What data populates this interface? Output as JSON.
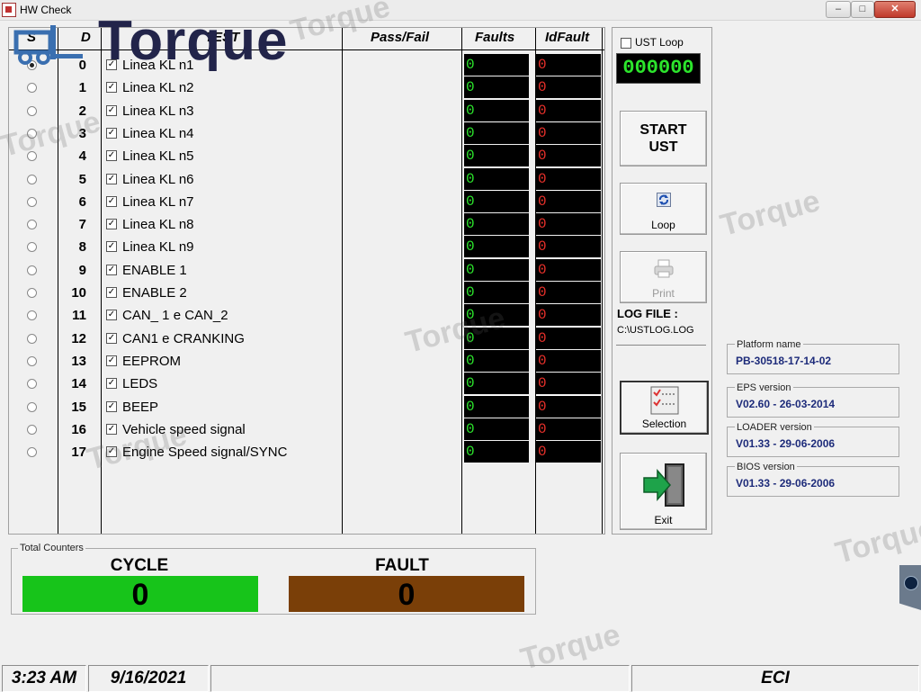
{
  "window": {
    "title": "HW Check"
  },
  "logo": {
    "text": "Torque"
  },
  "watermark": "Torque",
  "table": {
    "headers": {
      "sel": "S",
      "id": "D",
      "test": "TEST",
      "passfail": "Pass/Fail",
      "faults": "Faults",
      "idfault": "IdFault"
    },
    "rows": [
      {
        "id": "0",
        "name": "Linea KL n1",
        "checked": true,
        "selected": true,
        "faults": "0",
        "idfault": "0"
      },
      {
        "id": "1",
        "name": "Linea KL n2",
        "checked": true,
        "selected": false,
        "faults": "0",
        "idfault": "0"
      },
      {
        "id": "2",
        "name": "Linea KL n3",
        "checked": true,
        "selected": false,
        "faults": "0",
        "idfault": "0"
      },
      {
        "id": "3",
        "name": "Linea KL n4",
        "checked": true,
        "selected": false,
        "faults": "0",
        "idfault": "0"
      },
      {
        "id": "4",
        "name": "Linea KL n5",
        "checked": true,
        "selected": false,
        "faults": "0",
        "idfault": "0"
      },
      {
        "id": "5",
        "name": "Linea KL n6",
        "checked": true,
        "selected": false,
        "faults": "0",
        "idfault": "0"
      },
      {
        "id": "6",
        "name": "Linea KL n7",
        "checked": true,
        "selected": false,
        "faults": "0",
        "idfault": "0"
      },
      {
        "id": "7",
        "name": "Linea KL n8",
        "checked": true,
        "selected": false,
        "faults": "0",
        "idfault": "0"
      },
      {
        "id": "8",
        "name": "Linea KL n9",
        "checked": true,
        "selected": false,
        "faults": "0",
        "idfault": "0"
      },
      {
        "id": "9",
        "name": "ENABLE 1",
        "checked": true,
        "selected": false,
        "faults": "0",
        "idfault": "0"
      },
      {
        "id": "10",
        "name": "ENABLE 2",
        "checked": true,
        "selected": false,
        "faults": "0",
        "idfault": "0"
      },
      {
        "id": "11",
        "name": "CAN_ 1 e CAN_2",
        "checked": true,
        "selected": false,
        "faults": "0",
        "idfault": "0"
      },
      {
        "id": "12",
        "name": "CAN1 e CRANKING",
        "checked": true,
        "selected": false,
        "faults": "0",
        "idfault": "0"
      },
      {
        "id": "13",
        "name": "EEPROM",
        "checked": true,
        "selected": false,
        "faults": "0",
        "idfault": "0"
      },
      {
        "id": "14",
        "name": "LEDS",
        "checked": true,
        "selected": false,
        "faults": "0",
        "idfault": "0"
      },
      {
        "id": "15",
        "name": "BEEP",
        "checked": true,
        "selected": false,
        "faults": "0",
        "idfault": "0"
      },
      {
        "id": "16",
        "name": "Vehicle speed signal",
        "checked": true,
        "selected": false,
        "faults": "0",
        "idfault": "0"
      },
      {
        "id": "17",
        "name": "Engine Speed signal/SYNC",
        "checked": true,
        "selected": false,
        "faults": "0",
        "idfault": "0"
      }
    ]
  },
  "ust": {
    "loop_label": "UST Loop",
    "loop_checked": false,
    "counter": "000000",
    "start_line1": "START",
    "start_line2": "UST",
    "loop_button": "Loop",
    "print_button": "Print",
    "log_title": "LOG FILE :",
    "log_path": "C:\\USTLOG.LOG",
    "selection_button": "Selection",
    "exit_button": "Exit"
  },
  "info": [
    {
      "title": "Platform name",
      "value": "PB-30518-17-14-02"
    },
    {
      "title": "EPS version",
      "value": "V02.60 - 26-03-2014"
    },
    {
      "title": "LOADER version",
      "value": "V01.33 - 29-06-2006"
    },
    {
      "title": "BIOS version",
      "value": "V01.33 - 29-06-2006"
    }
  ],
  "totals": {
    "title": "Total Counters",
    "cycle_label": "CYCLE",
    "cycle_value": "0",
    "fault_label": "FAULT",
    "fault_value": "0"
  },
  "status": {
    "time": "3:23 AM",
    "date": "9/16/2021",
    "right": "ECI"
  },
  "colors": {
    "fault_green": "#2ce52c",
    "fault_red": "#e8302a",
    "cycle_box": "#17c41a",
    "fault_box": "#7a3f08",
    "info_value": "#1d2b7a"
  }
}
